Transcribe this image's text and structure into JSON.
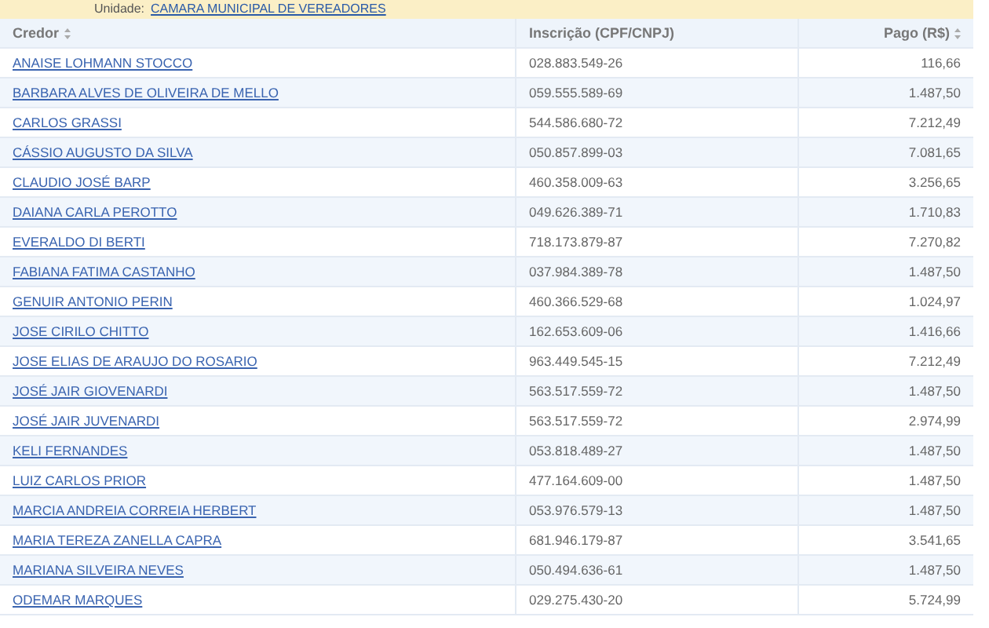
{
  "banner": {
    "label": "Unidade:",
    "unit": "CAMARA MUNICIPAL DE VEREADORES"
  },
  "table": {
    "columns": [
      {
        "label": "Credor",
        "sortable": true
      },
      {
        "label": "Inscrição (CPF/CNPJ)",
        "sortable": false
      },
      {
        "label": "Pago (R$)",
        "sortable": true
      }
    ],
    "rows": [
      {
        "credor": "ANAISE LOHMANN STOCCO",
        "inscricao": "028.883.549-26",
        "pago": "116,66"
      },
      {
        "credor": "BARBARA ALVES DE OLIVEIRA DE MELLO",
        "inscricao": "059.555.589-69",
        "pago": "1.487,50"
      },
      {
        "credor": "CARLOS GRASSI",
        "inscricao": "544.586.680-72",
        "pago": "7.212,49"
      },
      {
        "credor": "CÁSSIO AUGUSTO DA SILVA",
        "inscricao": "050.857.899-03",
        "pago": "7.081,65"
      },
      {
        "credor": "CLAUDIO JOSÉ BARP",
        "inscricao": "460.358.009-63",
        "pago": "3.256,65"
      },
      {
        "credor": "DAIANA CARLA PEROTTO",
        "inscricao": "049.626.389-71",
        "pago": "1.710,83"
      },
      {
        "credor": "EVERALDO DI BERTI",
        "inscricao": "718.173.879-87",
        "pago": "7.270,82"
      },
      {
        "credor": "FABIANA FATIMA CASTANHO",
        "inscricao": "037.984.389-78",
        "pago": "1.487,50"
      },
      {
        "credor": "GENUIR ANTONIO PERIN",
        "inscricao": "460.366.529-68",
        "pago": "1.024,97"
      },
      {
        "credor": "JOSE CIRILO CHITTO",
        "inscricao": "162.653.609-06",
        "pago": "1.416,66"
      },
      {
        "credor": "JOSE ELIAS DE ARAUJO DO ROSARIO",
        "inscricao": "963.449.545-15",
        "pago": "7.212,49"
      },
      {
        "credor": "JOSÉ JAIR GIOVENARDI",
        "inscricao": "563.517.559-72",
        "pago": "1.487,50"
      },
      {
        "credor": "JOSÉ JAIR JUVENARDI",
        "inscricao": "563.517.559-72",
        "pago": "2.974,99"
      },
      {
        "credor": "KELI FERNANDES",
        "inscricao": "053.818.489-27",
        "pago": "1.487,50"
      },
      {
        "credor": "LUIZ CARLOS PRIOR",
        "inscricao": "477.164.609-00",
        "pago": "1.487,50"
      },
      {
        "credor": "MARCIA ANDREIA CORREIA HERBERT",
        "inscricao": "053.976.579-13",
        "pago": "1.487,50"
      },
      {
        "credor": "MARIA TEREZA ZANELLA CAPRA",
        "inscricao": "681.946.179-87",
        "pago": "3.541,65"
      },
      {
        "credor": "MARIANA SILVEIRA NEVES",
        "inscricao": "050.494.636-61",
        "pago": "1.487,50"
      },
      {
        "credor": "ODEMAR MARQUES",
        "inscricao": "029.275.430-20",
        "pago": "5.724,99"
      }
    ]
  }
}
